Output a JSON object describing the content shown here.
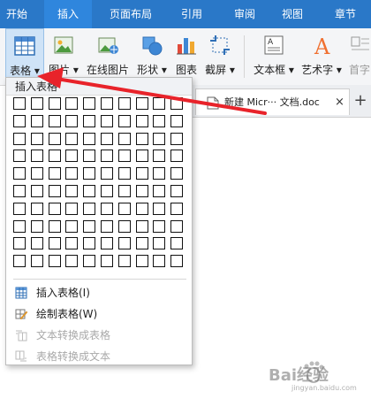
{
  "tabs": [
    {
      "label": "开始",
      "active": false
    },
    {
      "label": "插入",
      "active": true
    },
    {
      "label": "页面布局",
      "active": false
    },
    {
      "label": "引用",
      "active": false
    },
    {
      "label": "审阅",
      "active": false
    },
    {
      "label": "视图",
      "active": false
    },
    {
      "label": "章节",
      "active": false
    }
  ],
  "ribbon": {
    "table": "表格",
    "picture": "图片",
    "online_picture": "在线图片",
    "shapes": "形状",
    "chart": "图表",
    "screenshot": "截屏",
    "textbox": "文本框",
    "wordart": "艺术字",
    "dropcap": "首字"
  },
  "doc_tab": {
    "name": "新建 Micr··· 文档.doc",
    "close": "×",
    "new_tab": "+"
  },
  "menu": {
    "title": "插入表格",
    "grid_rows": 10,
    "grid_cols": 10,
    "items": [
      {
        "label": "插入表格(I)",
        "enabled": true,
        "icon": "table-icon"
      },
      {
        "label": "绘制表格(W)",
        "enabled": true,
        "icon": "pencil-table-icon"
      },
      {
        "label": "文本转换成表格",
        "enabled": false,
        "icon": "text-to-table-icon"
      },
      {
        "label": "表格转换成文本",
        "enabled": false,
        "icon": "table-to-text-icon"
      }
    ]
  },
  "watermark": {
    "text": "Bai经验",
    "sub": "jingyan.baidu.com"
  },
  "colors": {
    "tabbar": "#2a78c8",
    "annotation_arrow": "#e8232a"
  }
}
